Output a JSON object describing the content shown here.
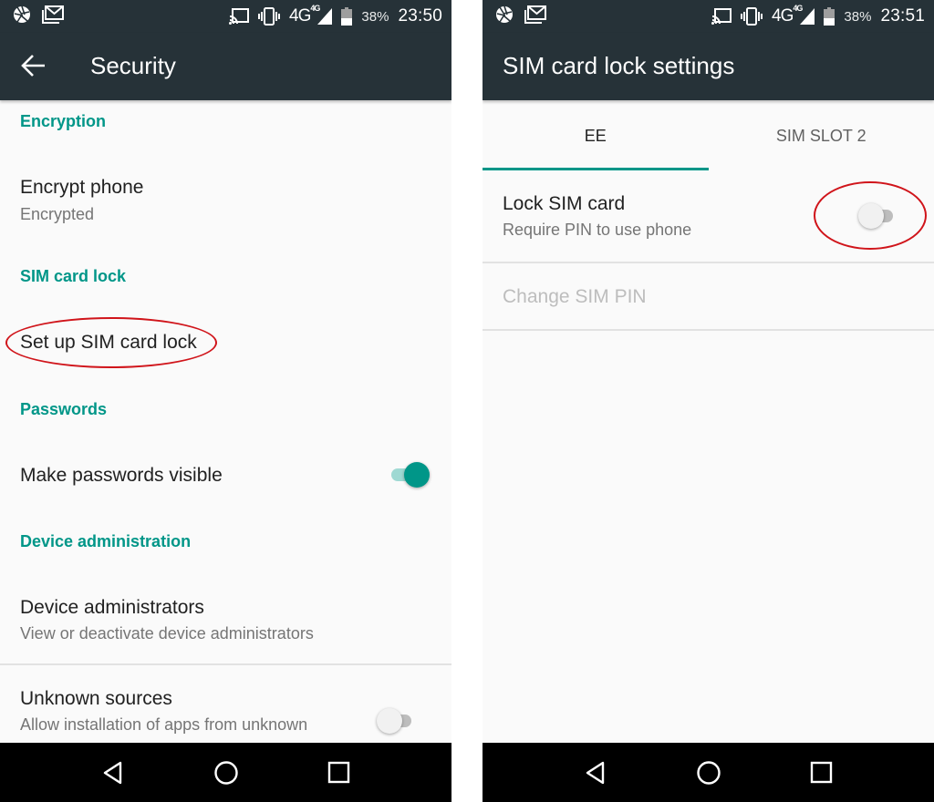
{
  "left_screen": {
    "status_bar": {
      "notification_icons": [
        "aperture-icon",
        "gmail-icon"
      ],
      "system_icons": [
        "cast-icon",
        "vibrate-icon",
        "4g-signal-icon",
        "battery-icon"
      ],
      "network_label": "4G",
      "network_superscript": "4G",
      "battery_percent": "38%",
      "time": "23:50"
    },
    "app_bar": {
      "title": "Security",
      "back_icon": "arrow-back-icon"
    },
    "sections": [
      {
        "category": "Encryption",
        "items": [
          {
            "title": "Encrypt phone",
            "summary": "Encrypted"
          }
        ]
      },
      {
        "category": "SIM card lock",
        "items": [
          {
            "title": "Set up SIM card lock",
            "annotated": true
          }
        ]
      },
      {
        "category": "Passwords",
        "items": [
          {
            "title": "Make passwords visible",
            "switch": true,
            "checked": true
          }
        ]
      },
      {
        "category": "Device administration",
        "items": [
          {
            "title": "Device administrators",
            "summary": "View or deactivate device administrators"
          },
          {
            "title": "Unknown sources",
            "summary": "Allow installation of apps from unknown",
            "switch": true,
            "checked": false
          }
        ]
      }
    ],
    "nav_bar": {
      "back": "nav-back-icon",
      "home": "nav-home-icon",
      "recents": "nav-recents-icon"
    }
  },
  "right_screen": {
    "status_bar": {
      "notification_icons": [
        "aperture-icon",
        "gmail-icon"
      ],
      "system_icons": [
        "cast-icon",
        "vibrate-icon",
        "4g-signal-icon",
        "battery-icon"
      ],
      "network_label": "4G",
      "network_superscript": "4G",
      "battery_percent": "38%",
      "time": "23:51"
    },
    "app_bar": {
      "title": "SIM card lock settings"
    },
    "tabs": [
      {
        "label": "EE",
        "active": true
      },
      {
        "label": "SIM SLOT 2",
        "active": false
      }
    ],
    "items": [
      {
        "title": "Lock SIM card",
        "summary": "Require PIN to use phone",
        "switch": true,
        "checked": false,
        "annotated": true
      },
      {
        "title": "Change SIM PIN",
        "enabled": false
      }
    ],
    "nav_bar": {
      "back": "nav-back-icon",
      "home": "nav-home-icon",
      "recents": "nav-recents-icon"
    }
  },
  "colors": {
    "accent": "#009688",
    "toolbar": "#263238",
    "annotation": "#d0141a"
  }
}
